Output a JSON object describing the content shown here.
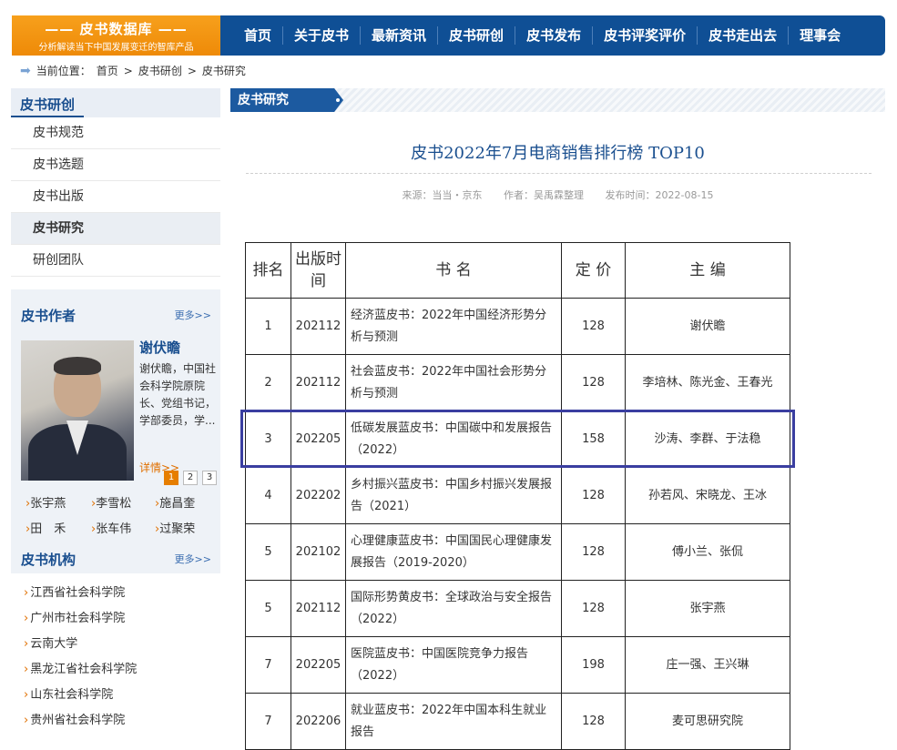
{
  "header": {
    "logo_title": "—— 皮书数据库 ——",
    "logo_subtitle": "分析解读当下中国发展变迁的智库产品",
    "nav": [
      "首页",
      "关于皮书",
      "最新资讯",
      "皮书研创",
      "皮书发布",
      "皮书评奖评价",
      "皮书走出去",
      "理事会"
    ]
  },
  "breadcrumb": {
    "label": "当前位置：",
    "items": [
      "首页",
      "皮书研创",
      "皮书研究"
    ],
    "sep": ">"
  },
  "sidebar": {
    "title": "皮书研创",
    "items": [
      {
        "label": "皮书规范",
        "active": false
      },
      {
        "label": "皮书选题",
        "active": false
      },
      {
        "label": "皮书出版",
        "active": false
      },
      {
        "label": "皮书研究",
        "active": true
      },
      {
        "label": "研创团队",
        "active": false
      }
    ]
  },
  "authors": {
    "title": "皮书作者",
    "more": "更多>>",
    "featured_name": "谢伏瞻",
    "featured_desc": "谢伏瞻，中国社会科学院原院长、党组书记，学部委员，学...",
    "featured_more": "详情>>",
    "pages": [
      "1",
      "2",
      "3"
    ],
    "current_page": "1",
    "links": [
      "张宇燕",
      "李雪松",
      "施昌奎",
      "田　禾",
      "张车伟",
      "过聚荣"
    ]
  },
  "orgs": {
    "title": "皮书机构",
    "more": "更多>>",
    "items": [
      "江西省社会科学院",
      "广州市社会科学院",
      "云南大学",
      "黑龙江省社会科学院",
      "山东社会科学院",
      "贵州省社会科学院"
    ]
  },
  "article": {
    "tab": "皮书研究",
    "title": "皮书2022年7月电商销售排行榜 TOP10",
    "source": "来源：当当・京东",
    "author": "作者：吴禹霖整理",
    "date": "发布时间：2022-08-15"
  },
  "table": {
    "headers": [
      "排名",
      "出版时间",
      "书 名",
      "定 价",
      "主 编"
    ],
    "rows": [
      {
        "rank": "1",
        "date": "202112",
        "name": "经济蓝皮书：2022年中国经济形势分析与预测",
        "price": "128",
        "editor": "谢伏瞻"
      },
      {
        "rank": "2",
        "date": "202112",
        "name": "社会蓝皮书：2022年中国社会形势分析与预测",
        "price": "128",
        "editor": "李培林、陈光金、王春光"
      },
      {
        "rank": "3",
        "date": "202205",
        "name": "低碳发展蓝皮书：中国碳中和发展报告（2022）",
        "price": "158",
        "editor": "沙涛、李群、于法稳"
      },
      {
        "rank": "4",
        "date": "202202",
        "name": "乡村振兴蓝皮书：中国乡村振兴发展报告（2021）",
        "price": "128",
        "editor": "孙若风、宋晓龙、王冰"
      },
      {
        "rank": "5",
        "date": "202102",
        "name": "心理健康蓝皮书：中国国民心理健康发展报告（2019-2020）",
        "price": "128",
        "editor": "傅小兰、张侃"
      },
      {
        "rank": "5",
        "date": "202112",
        "name": "国际形势黄皮书：全球政治与安全报告（2022）",
        "price": "128",
        "editor": "张宇燕"
      },
      {
        "rank": "7",
        "date": "202205",
        "name": "医院蓝皮书：中国医院竞争力报告（2022）",
        "price": "198",
        "editor": "庄一强、王兴琳"
      },
      {
        "rank": "7",
        "date": "202206",
        "name": "就业蓝皮书：2022年中国本科生就业报告",
        "price": "128",
        "editor": "麦可思研究院"
      }
    ]
  }
}
